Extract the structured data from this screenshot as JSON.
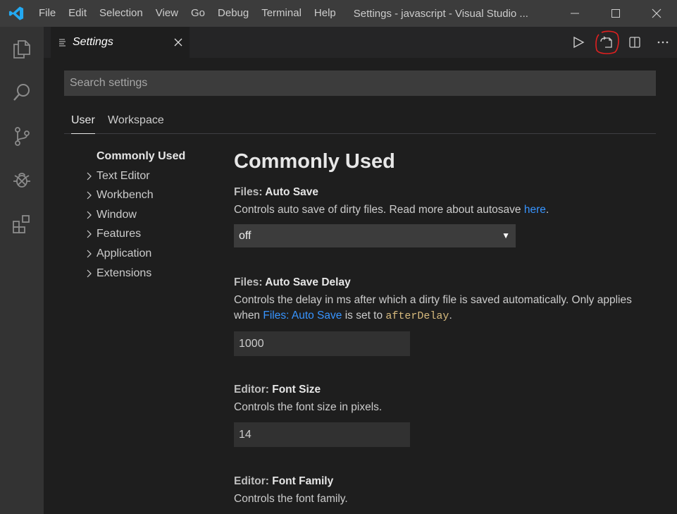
{
  "titlebar": {
    "menu": [
      "File",
      "Edit",
      "Selection",
      "View",
      "Go",
      "Debug",
      "Terminal",
      "Help"
    ],
    "title": "Settings - javascript - Visual Studio ...",
    "icons": [
      "vscode-logo",
      "minimize-icon",
      "maximize-icon",
      "close-icon"
    ]
  },
  "activitybar": {
    "items": [
      "explorer-icon",
      "search-icon",
      "source-control-icon",
      "debug-icon",
      "extensions-icon"
    ]
  },
  "tab": {
    "label": "Settings",
    "icon": "settings-list-icon"
  },
  "editor_actions": [
    "run-icon",
    "open-settings-json-icon",
    "split-editor-icon",
    "more-actions-icon"
  ],
  "annotation": {
    "color": "#e02020",
    "target": "open-settings-json-icon"
  },
  "search": {
    "placeholder": "Search settings"
  },
  "scope_tabs": {
    "user": "User",
    "workspace": "Workspace",
    "active": "User"
  },
  "toc": {
    "items": [
      "Commonly Used",
      "Text Editor",
      "Workbench",
      "Window",
      "Features",
      "Application",
      "Extensions"
    ],
    "active": "Commonly Used"
  },
  "section_title": "Commonly Used",
  "settings": {
    "auto_save": {
      "category": "Files: ",
      "name": "Auto Save",
      "desc": "Controls auto save of dirty files. Read more about autosave ",
      "link": "here",
      "desc_end": ".",
      "value": "off",
      "arrow": "▼"
    },
    "auto_save_delay": {
      "category": "Files: ",
      "name": "Auto Save Delay",
      "desc_a": "Controls the delay in ms after which a dirty file is saved automatically. Only applies when ",
      "link": "Files: Auto Save",
      "desc_b": " is set to ",
      "code": "afterDelay",
      "desc_end": ".",
      "value": "1000"
    },
    "font_size": {
      "category": "Editor: ",
      "name": "Font Size",
      "desc": "Controls the font size in pixels.",
      "value": "14"
    },
    "font_family": {
      "category": "Editor: ",
      "name": "Font Family",
      "desc": "Controls the font family."
    }
  },
  "colors": {
    "titlebar": "#3c3c3c",
    "activitybar": "#333333",
    "editor": "#1e1e1e",
    "vscode_blue": "#23a9f2",
    "link": "#3794ff"
  }
}
